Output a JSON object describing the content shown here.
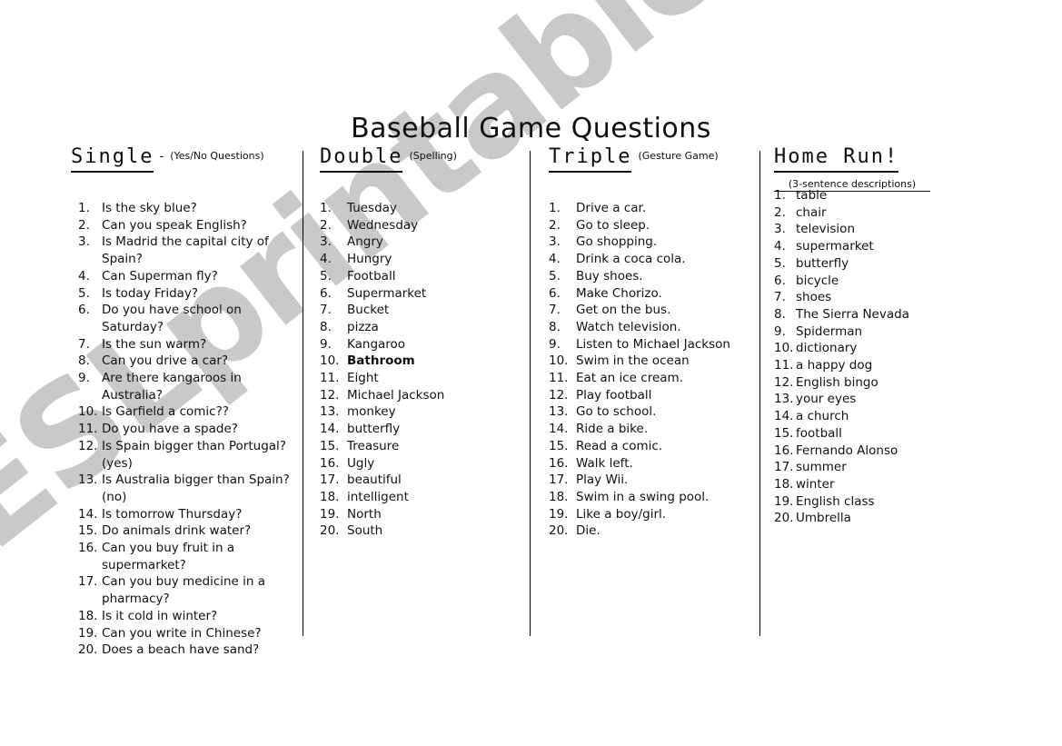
{
  "document": {
    "title": "Baseball Game Questions",
    "watermark": "ESLprintables.com"
  },
  "columns": [
    {
      "key": "single",
      "title": "Single",
      "dash": "-",
      "subtitle": "(Yes/No Questions)",
      "items": [
        {
          "num": "1.",
          "text": "Is the sky blue?"
        },
        {
          "num": "2.",
          "text": "Can you speak English?"
        },
        {
          "num": "3.",
          "text": "Is Madrid the capital city of Spain?"
        },
        {
          "num": "4.",
          "text": "Can Superman fly?"
        },
        {
          "num": "5.",
          "text": "Is today Friday?"
        },
        {
          "num": "6.",
          "text": "Do you have school on Saturday?"
        },
        {
          "num": "7.",
          "text": "Is the sun warm?"
        },
        {
          "num": "8.",
          "text": "Can you drive a car?"
        },
        {
          "num": "9.",
          "text": "Are there kangaroos in Australia?"
        },
        {
          "num": "10.",
          "text": "Is Garfield a comic??"
        },
        {
          "num": "11.",
          "text": "Do you have a spade?"
        },
        {
          "num": "12.",
          "text": "Is Spain bigger than Portugal?",
          "note": "(yes)"
        },
        {
          "num": "13.",
          "text": "Is Australia bigger than Spain?",
          "note": "(no)"
        },
        {
          "num": "14.",
          "text": "Is tomorrow Thursday?"
        },
        {
          "num": "15.",
          "text": "Do animals drink water?"
        },
        {
          "num": "16.",
          "text": "Can you buy fruit in a supermarket?"
        },
        {
          "num": "17.",
          "text": "Can you buy medicine in a pharmacy?"
        },
        {
          "num": "18.",
          "text": "Is it cold in winter?"
        },
        {
          "num": "19.",
          "text": "Can you write in Chinese?"
        },
        {
          "num": "20.",
          "text": "Does a beach have sand?"
        }
      ]
    },
    {
      "key": "double",
      "title": "Double",
      "dash": "",
      "subtitle": "(Spelling)",
      "items": [
        {
          "num": "1.",
          "text": "Tuesday"
        },
        {
          "num": "2.",
          "text": "Wednesday"
        },
        {
          "num": "3.",
          "text": "Angry"
        },
        {
          "num": "4.",
          "text": "Hungry"
        },
        {
          "num": "5.",
          "text": "Football"
        },
        {
          "num": "6.",
          "text": "Supermarket"
        },
        {
          "num": "7.",
          "text": "Bucket"
        },
        {
          "num": "8.",
          "text": "pizza"
        },
        {
          "num": "9.",
          "text": "Kangaroo"
        },
        {
          "num": "10.",
          "text": "Bathroom",
          "bold": true
        },
        {
          "num": "11.",
          "text": "Eight"
        },
        {
          "num": "12.",
          "text": "Michael Jackson"
        },
        {
          "num": "13.",
          "text": "monkey"
        },
        {
          "num": "14.",
          "text": "butterfly"
        },
        {
          "num": "15.",
          "text": "Treasure"
        },
        {
          "num": "16.",
          "text": "Ugly"
        },
        {
          "num": "17.",
          "text": "beautiful"
        },
        {
          "num": "18.",
          "text": "intelligent"
        },
        {
          "num": "19.",
          "text": "North"
        },
        {
          "num": "20.",
          "text": "South"
        }
      ]
    },
    {
      "key": "triple",
      "title": "Triple",
      "dash": "",
      "subtitle": "(Gesture Game)",
      "items": [
        {
          "num": "1.",
          "text": "Drive a car."
        },
        {
          "num": "2.",
          "text": "Go to sleep."
        },
        {
          "num": "3.",
          "text": "Go shopping."
        },
        {
          "num": "4.",
          "text": "Drink a coca cola."
        },
        {
          "num": "5.",
          "text": "Buy shoes."
        },
        {
          "num": "6.",
          "text": "Make Chorizo."
        },
        {
          "num": "7.",
          "text": "Get on the bus."
        },
        {
          "num": "8.",
          "text": "Watch television."
        },
        {
          "num": "9.",
          "text": "Listen to Michael Jackson"
        },
        {
          "num": "10.",
          "text": "Swim in the ocean"
        },
        {
          "num": "11.",
          "text": "Eat an ice cream."
        },
        {
          "num": "12.",
          "text": "Play football"
        },
        {
          "num": "13.",
          "text": "Go to school."
        },
        {
          "num": "14.",
          "text": "Ride a bike."
        },
        {
          "num": "15.",
          "text": "Read a comic."
        },
        {
          "num": "16.",
          "text": "Walk left."
        },
        {
          "num": "17.",
          "text": "Play Wii."
        },
        {
          "num": "18.",
          "text": "Swim in a swing pool."
        },
        {
          "num": "19.",
          "text": "Like a boy/girl."
        },
        {
          "num": "20.",
          "text": "Die."
        }
      ]
    },
    {
      "key": "homerun",
      "title": "Home Run!",
      "dash": "",
      "subtitle": "(3-sentence descriptions)",
      "subtitle_boxed": true,
      "items": [
        {
          "num": "1.",
          "text": "table"
        },
        {
          "num": "2.",
          "text": "chair"
        },
        {
          "num": "3.",
          "text": "television"
        },
        {
          "num": "4.",
          "text": "supermarket"
        },
        {
          "num": "5.",
          "text": "butterfly"
        },
        {
          "num": "6.",
          "text": "bicycle"
        },
        {
          "num": "7.",
          "text": "shoes"
        },
        {
          "num": "8.",
          "text": "The Sierra Nevada"
        },
        {
          "num": "9.",
          "text": "Spiderman"
        },
        {
          "num": "10.",
          "text": "dictionary"
        },
        {
          "num": "11.",
          "text": "a happy dog"
        },
        {
          "num": "12.",
          "text": "English bingo"
        },
        {
          "num": "13.",
          "text": "your eyes"
        },
        {
          "num": "14.",
          "text": "a church"
        },
        {
          "num": "15.",
          "text": "football"
        },
        {
          "num": "16.",
          "text": "Fernando Alonso"
        },
        {
          "num": "17.",
          "text": "summer"
        },
        {
          "num": "18.",
          "text": "winter"
        },
        {
          "num": "19.",
          "text": "English class"
        },
        {
          "num": "20.",
          "text": "Umbrella"
        }
      ]
    }
  ]
}
